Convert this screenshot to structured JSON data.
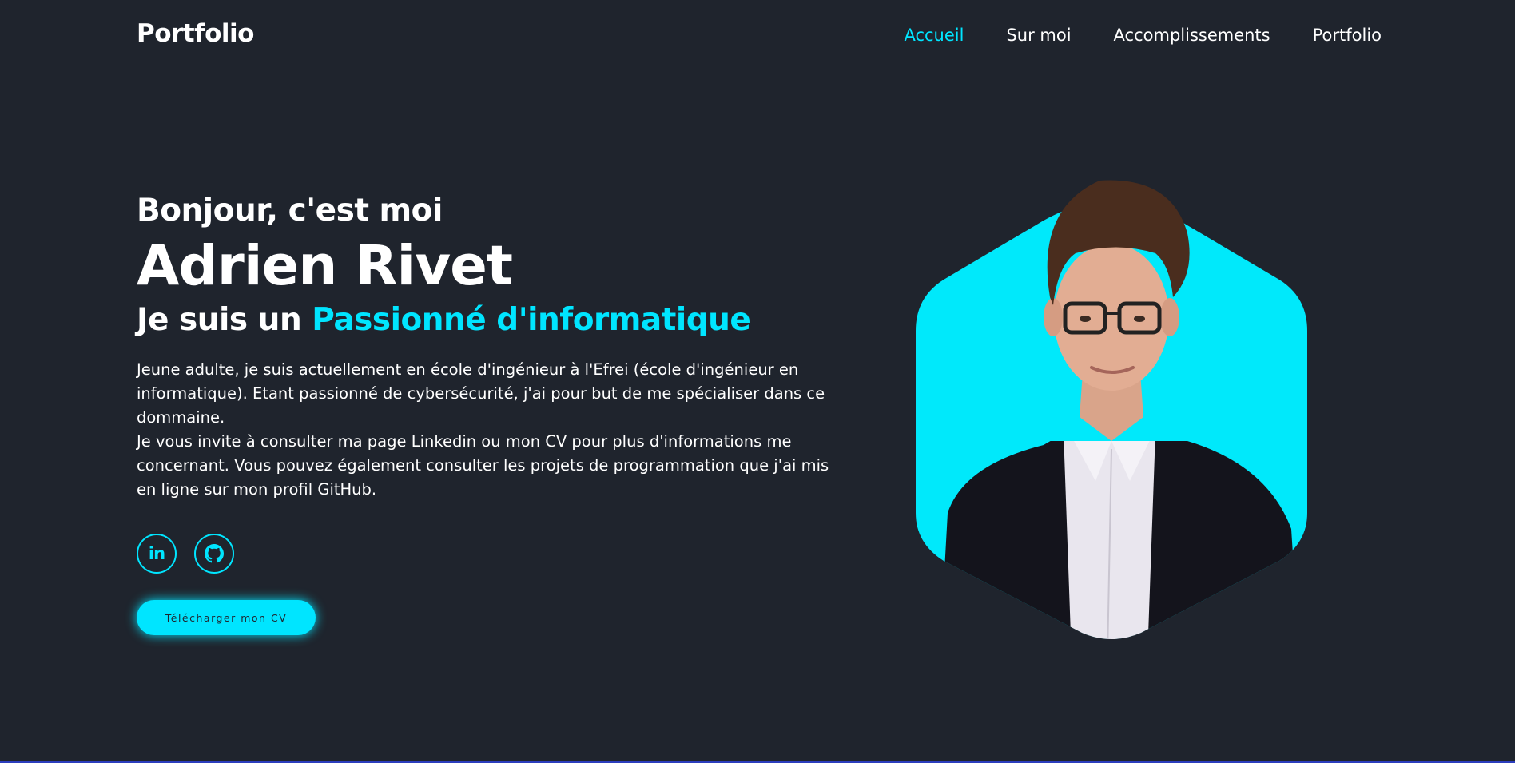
{
  "header": {
    "logo": "Portfolio",
    "nav": [
      {
        "label": "Accueil",
        "active": true
      },
      {
        "label": "Sur moi",
        "active": false
      },
      {
        "label": "Accomplissements",
        "active": false
      },
      {
        "label": "Portfolio",
        "active": false
      }
    ]
  },
  "home": {
    "greeting": "Bonjour, c'est moi",
    "name": "Adrien Rivet",
    "role_prefix": "Je suis un ",
    "role_highlight": "Passionné d'informatique",
    "bio_line1": "Jeune adulte, je suis actuellement en école d'ingénieur à l'Efrei (école d'ingénieur en informatique). Etant passionné de cybersécurité, j'ai pour but de me spécialiser dans ce dommaine.",
    "bio_line2": "Je vous invite à consulter ma page Linkedin ou mon CV pour plus d'informations me concernant. Vous pouvez également consulter les projets de programmation que j'ai mis en ligne sur mon profil GitHub.",
    "socials": [
      {
        "name": "linkedin",
        "icon": "linkedin-icon",
        "label": "in"
      },
      {
        "name": "github",
        "icon": "github-icon"
      }
    ],
    "cv_button": "Télécharger mon CV"
  },
  "colors": {
    "background": "#1f242d",
    "accent": "#00e5ff",
    "text": "#ffffff",
    "bottom_line": "#2b3dbd"
  }
}
